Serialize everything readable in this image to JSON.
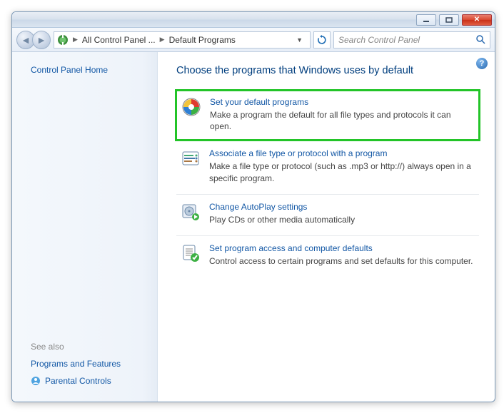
{
  "breadcrumb": {
    "root": "All Control Panel ...",
    "leaf": "Default Programs"
  },
  "search": {
    "placeholder": "Search Control Panel"
  },
  "sidebar": {
    "home_label": "Control Panel Home",
    "see_also_label": "See also",
    "links": [
      {
        "label": "Programs and Features"
      },
      {
        "label": "Parental Controls"
      }
    ]
  },
  "main": {
    "heading": "Choose the programs that Windows uses by default",
    "options": [
      {
        "title": "Set your default programs",
        "desc": "Make a program the default for all file types and protocols it can open.",
        "highlighted": true
      },
      {
        "title": "Associate a file type or protocol with a program",
        "desc": "Make a file type or protocol (such as .mp3 or http://) always open in a specific program."
      },
      {
        "title": "Change AutoPlay settings",
        "desc": "Play CDs or other media automatically"
      },
      {
        "title": "Set program access and computer defaults",
        "desc": "Control access to certain programs and set defaults for this computer."
      }
    ]
  }
}
